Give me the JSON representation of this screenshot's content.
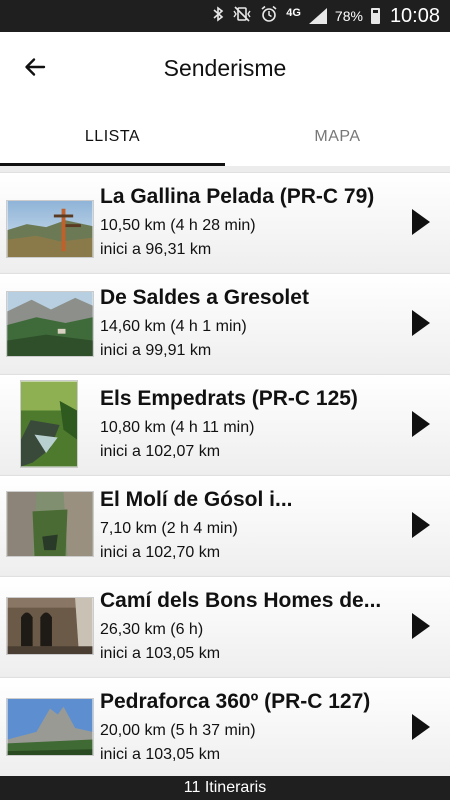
{
  "status_bar": {
    "icons": [
      "bluetooth-icon",
      "vibrate-icon",
      "alarm-icon"
    ],
    "network": "4G",
    "battery_percent": "78%",
    "time": "10:08"
  },
  "header": {
    "back_icon": "arrow-left-icon",
    "title": "Senderisme"
  },
  "tabs": [
    {
      "label": "LLISTA",
      "active": true
    },
    {
      "label": "MAPA",
      "active": false
    }
  ],
  "routes": [
    {
      "name": "La Gallina Pelada (PR-C 79)",
      "distance": "10,50 km (4 h 28 min)",
      "start": "inici a 96,31 km"
    },
    {
      "name": "De Saldes a Gresolet",
      "distance": "14,60 km (4 h 1 min)",
      "start": "inici a 99,91 km"
    },
    {
      "name": "Els Empedrats (PR-C 125)",
      "distance": "10,80 km (4 h 11 min)",
      "start": "inici a 102,07 km"
    },
    {
      "name": "El Molí de Gósol i...",
      "distance": "7,10 km (2 h 4 min)",
      "start": "inici a 102,70 km"
    },
    {
      "name": "Camí dels Bons Homes de...",
      "distance": "26,30 km (6 h)",
      "start": "inici a 103,05 km"
    },
    {
      "name": "Pedraforca 360º (PR-C 127)",
      "distance": "20,00 km (5 h 37 min)",
      "start": "inici a 103,05 km"
    }
  ],
  "footer": {
    "count_label": "11 Itineraris"
  }
}
